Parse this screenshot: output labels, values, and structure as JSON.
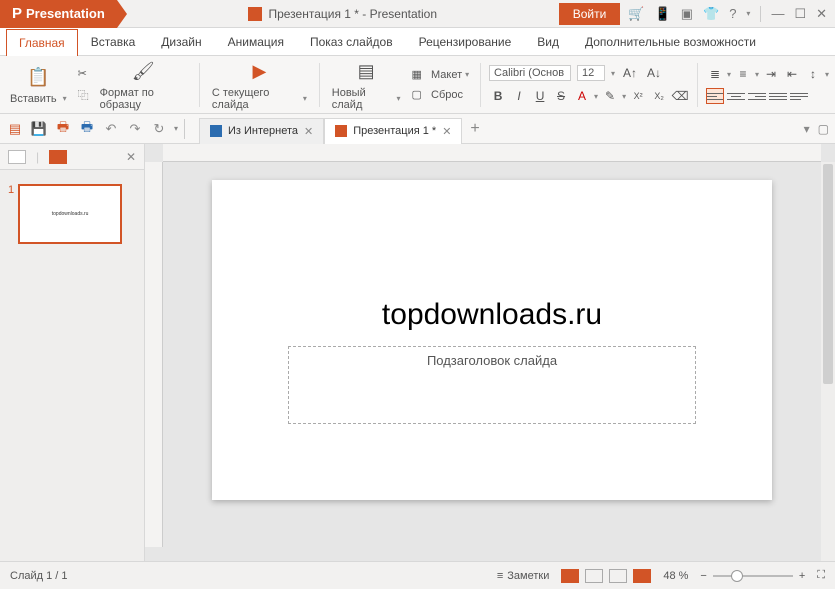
{
  "titlebar": {
    "app_name": "Presentation",
    "doc_title": "Презентация 1 * - Presentation",
    "login": "Войти"
  },
  "menu": {
    "tabs": [
      "Главная",
      "Вставка",
      "Дизайн",
      "Анимация",
      "Показ слайдов",
      "Рецензирование",
      "Вид",
      "Дополнительные возможности"
    ],
    "active": 0
  },
  "ribbon": {
    "paste": "Вставить",
    "format_painter": "Формат по образцу",
    "from_current": "С текущего слайда",
    "new_slide": "Новый слайд",
    "layout": "Макет",
    "reset": "Сброс",
    "font_name": "Calibri (Основ",
    "font_size": "12"
  },
  "quickbar": {
    "internet_tab": "Из Интернета",
    "doc_tab": "Презентация 1 *"
  },
  "slide": {
    "title": "topdownloads.ru",
    "subtitle": "Подзаголовок слайда",
    "thumb_text": "topdownloads.ru"
  },
  "statusbar": {
    "slide_info": "Слайд 1 / 1",
    "notes": "Заметки",
    "zoom": "48 %"
  }
}
